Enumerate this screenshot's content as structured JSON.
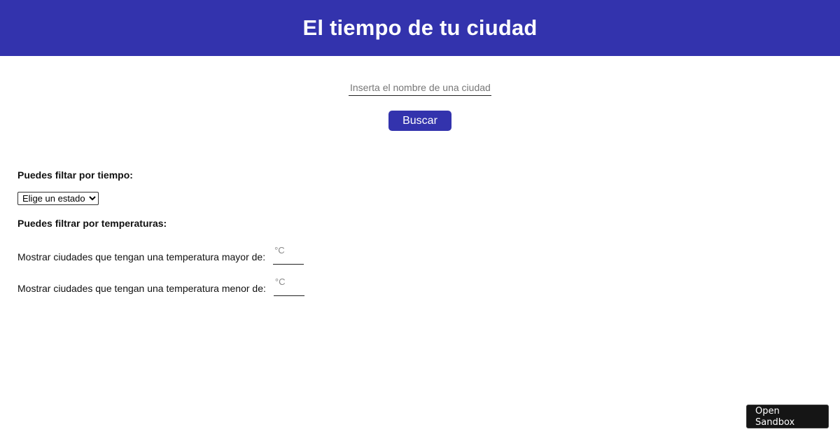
{
  "header": {
    "title": "El tiempo de tu ciudad"
  },
  "search": {
    "placeholder": "Inserta el nombre de una ciudad",
    "value": "",
    "button_label": "Buscar"
  },
  "filters": {
    "weather_heading": "Puedes filtar por tiempo:",
    "weather_select_value": "Elige un estado",
    "temperature_heading": "Puedes filtrar por temperaturas:",
    "min_temp_label": "Mostrar ciudades que tengan una temperatura mayor de:",
    "min_temp_placeholder": "°C",
    "max_temp_label": "Mostrar ciudades que tengan una temperatura menor de:",
    "max_temp_placeholder": "°C"
  },
  "sandbox": {
    "label": "Open Sandbox"
  },
  "colors": {
    "brand": "#3333ad",
    "sandbox_bg": "#151515"
  }
}
